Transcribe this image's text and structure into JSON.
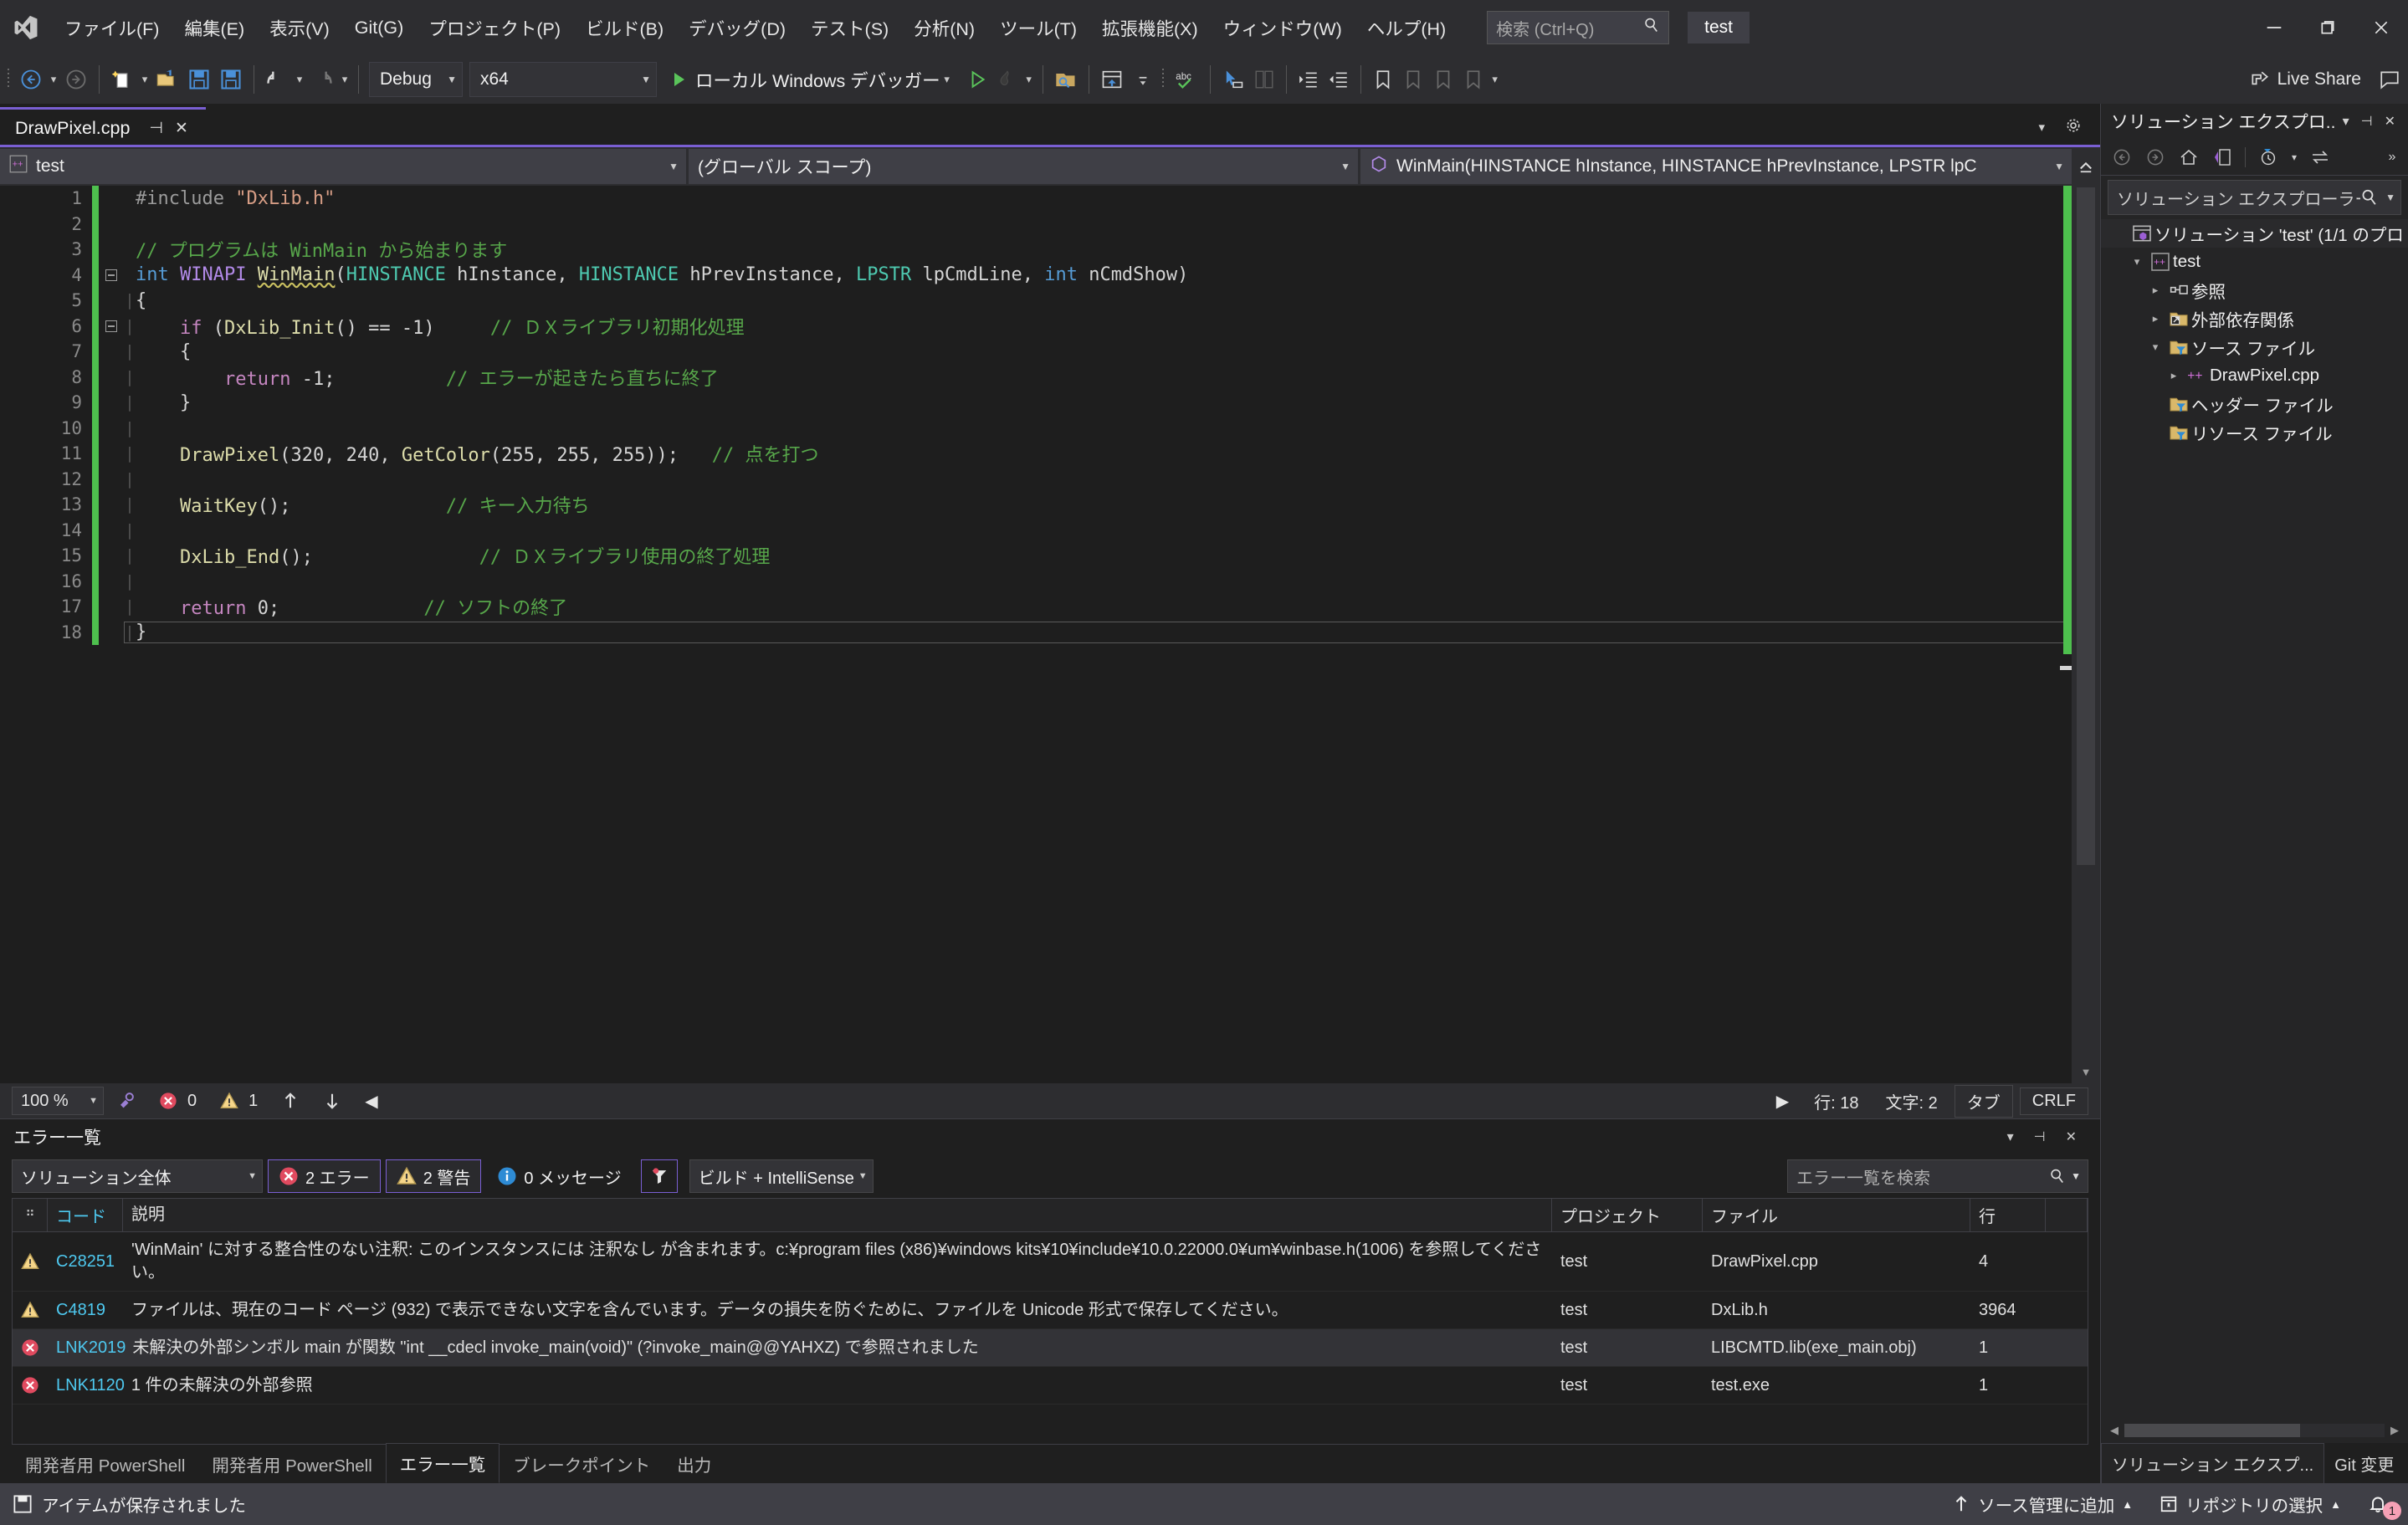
{
  "titlebar": {
    "menus": [
      "ファイル(F)",
      "編集(E)",
      "表示(V)",
      "Git(G)",
      "プロジェクト(P)",
      "ビルド(B)",
      "デバッグ(D)",
      "テスト(S)",
      "分析(N)",
      "ツール(T)",
      "拡張機能(X)",
      "ウィンドウ(W)",
      "ヘルプ(H)"
    ],
    "search_placeholder": "検索 (Ctrl+Q)",
    "project_badge": "test"
  },
  "toolbar": {
    "config": "Debug",
    "platform": "x64",
    "run_label": "ローカル Windows デバッガー",
    "live_share": "Live Share"
  },
  "editor": {
    "tab_name": "DrawPixel.cpp",
    "nav_project": "test",
    "nav_scope": "(グローバル スコープ)",
    "nav_function": "WinMain(HINSTANCE hInstance, HINSTANCE hPrevInstance, LPSTR lpC",
    "lines": [
      {
        "n": 1,
        "fold": "",
        "guide": "",
        "segs": [
          {
            "t": "#include ",
            "c": "k-pre"
          },
          {
            "t": "\"DxLib.h\"",
            "c": "k-str"
          }
        ]
      },
      {
        "n": 2,
        "fold": "",
        "guide": "",
        "segs": []
      },
      {
        "n": 3,
        "fold": "",
        "guide": "",
        "segs": [
          {
            "t": "// プログラムは WinMain から始まります",
            "c": "k-cmt"
          }
        ]
      },
      {
        "n": 4,
        "fold": "-",
        "guide": "",
        "segs": [
          {
            "t": "int",
            "c": "k-kw"
          },
          {
            "t": " ",
            "c": "k-plain"
          },
          {
            "t": "WINAPI",
            "c": "k-macro"
          },
          {
            "t": " ",
            "c": "k-plain"
          },
          {
            "t": "WinMain",
            "c": "k-fn squiggle"
          },
          {
            "t": "(",
            "c": "k-plain"
          },
          {
            "t": "HINSTANCE",
            "c": "k-type"
          },
          {
            "t": " hInstance, ",
            "c": "k-plain"
          },
          {
            "t": "HINSTANCE",
            "c": "k-type"
          },
          {
            "t": " hPrevInstance, ",
            "c": "k-plain"
          },
          {
            "t": "LPSTR",
            "c": "k-type"
          },
          {
            "t": " lpCmdLine, ",
            "c": "k-plain"
          },
          {
            "t": "int",
            "c": "k-kw"
          },
          {
            "t": " nCmdShow)",
            "c": "k-plain"
          }
        ]
      },
      {
        "n": 5,
        "fold": "",
        "guide": "|",
        "segs": [
          {
            "t": "{",
            "c": "k-plain"
          }
        ]
      },
      {
        "n": 6,
        "fold": "-",
        "guide": "|",
        "segs": [
          {
            "t": "    ",
            "c": "k-plain"
          },
          {
            "t": "if",
            "c": "k-kw2"
          },
          {
            "t": " (",
            "c": "k-plain"
          },
          {
            "t": "DxLib_Init",
            "c": "k-fn"
          },
          {
            "t": "() == -1)     ",
            "c": "k-plain"
          },
          {
            "t": "// ＤＸライブラリ初期化処理",
            "c": "k-cmt"
          }
        ]
      },
      {
        "n": 7,
        "fold": "",
        "guide": "|",
        "segs": [
          {
            "t": "    {",
            "c": "k-plain"
          }
        ]
      },
      {
        "n": 8,
        "fold": "",
        "guide": "|",
        "segs": [
          {
            "t": "        ",
            "c": "k-plain"
          },
          {
            "t": "return",
            "c": "k-kw2"
          },
          {
            "t": " -1;          ",
            "c": "k-plain"
          },
          {
            "t": "// エラーが起きたら直ちに終了",
            "c": "k-cmt"
          }
        ]
      },
      {
        "n": 9,
        "fold": "",
        "guide": "|",
        "segs": [
          {
            "t": "    }",
            "c": "k-plain"
          }
        ]
      },
      {
        "n": 10,
        "fold": "",
        "guide": "|",
        "segs": []
      },
      {
        "n": 11,
        "fold": "",
        "guide": "|",
        "segs": [
          {
            "t": "    ",
            "c": "k-plain"
          },
          {
            "t": "DrawPixel",
            "c": "k-fn"
          },
          {
            "t": "(320, 240, ",
            "c": "k-plain"
          },
          {
            "t": "GetColor",
            "c": "k-fn"
          },
          {
            "t": "(255, 255, 255));   ",
            "c": "k-plain"
          },
          {
            "t": "// 点を打つ",
            "c": "k-cmt"
          }
        ]
      },
      {
        "n": 12,
        "fold": "",
        "guide": "|",
        "segs": []
      },
      {
        "n": 13,
        "fold": "",
        "guide": "|",
        "segs": [
          {
            "t": "    ",
            "c": "k-plain"
          },
          {
            "t": "WaitKey",
            "c": "k-fn"
          },
          {
            "t": "();              ",
            "c": "k-plain"
          },
          {
            "t": "// キー入力待ち",
            "c": "k-cmt"
          }
        ]
      },
      {
        "n": 14,
        "fold": "",
        "guide": "|",
        "segs": []
      },
      {
        "n": 15,
        "fold": "",
        "guide": "|",
        "segs": [
          {
            "t": "    ",
            "c": "k-plain"
          },
          {
            "t": "DxLib_End",
            "c": "k-fn"
          },
          {
            "t": "();               ",
            "c": "k-plain"
          },
          {
            "t": "// ＤＸライブラリ使用の終了処理",
            "c": "k-cmt"
          }
        ]
      },
      {
        "n": 16,
        "fold": "",
        "guide": "|",
        "segs": []
      },
      {
        "n": 17,
        "fold": "",
        "guide": "|",
        "segs": [
          {
            "t": "    ",
            "c": "k-plain"
          },
          {
            "t": "return",
            "c": "k-kw2"
          },
          {
            "t": " 0;             ",
            "c": "k-plain"
          },
          {
            "t": "// ソフトの終了",
            "c": "k-cmt"
          }
        ]
      },
      {
        "n": 18,
        "fold": "",
        "guide": "|",
        "segs": [
          {
            "t": "}",
            "c": "k-plain"
          }
        ]
      }
    ],
    "status": {
      "zoom": "100 %",
      "error_count": "0",
      "warning_count": "1",
      "line": "行: 18",
      "col": "文字: 2",
      "tabs": "タブ",
      "eol": "CRLF"
    }
  },
  "errorlist": {
    "title": "エラー一覧",
    "scope": "ソリューション全体",
    "errors_toggle": "2 エラー",
    "warnings_toggle": "2 警告",
    "messages_toggle": "0 メッセージ",
    "build_filter": "ビルド + IntelliSense",
    "search_placeholder": "エラー一覧を検索",
    "columns": [
      "",
      "コード",
      "説明",
      "プロジェクト",
      "ファイル",
      "行",
      ""
    ],
    "rows": [
      {
        "severity": "warning",
        "code": "C28251",
        "description": "'WinMain' に対する整合性のない注釈: このインスタンスには 注釈なし が含まれます。c:¥program files (x86)¥windows kits¥10¥include¥10.0.22000.0¥um¥winbase.h(1006) を参照してください。",
        "project": "test",
        "file": "DrawPixel.cpp",
        "line": "4",
        "selected": false,
        "inline_code": false
      },
      {
        "severity": "warning",
        "code": "C4819",
        "description": "ファイルは、現在のコード ページ (932) で表示できない文字を含んでいます。データの損失を防ぐために、ファイルを Unicode 形式で保存してください。",
        "project": "test",
        "file": "DxLib.h",
        "line": "3964",
        "selected": false,
        "inline_code": false
      },
      {
        "severity": "error",
        "code": "LNK2019",
        "description": "未解決の外部シンボル main が関数 \"int __cdecl invoke_main(void)\" (?invoke_main@@YAHXZ) で参照されました",
        "project": "test",
        "file": "LIBCMTD.lib(exe_main.obj)",
        "line": "1",
        "selected": true,
        "inline_code": true
      },
      {
        "severity": "error",
        "code": "LNK1120",
        "description": "1 件の未解決の外部参照",
        "project": "test",
        "file": "test.exe",
        "line": "1",
        "selected": false,
        "inline_code": true
      }
    ],
    "footer_tabs": [
      {
        "label": "開発者用 PowerShell",
        "active": false
      },
      {
        "label": "開発者用 PowerShell",
        "active": false
      },
      {
        "label": "エラー一覧",
        "active": true
      },
      {
        "label": "ブレークポイント",
        "active": false
      },
      {
        "label": "出力",
        "active": false
      }
    ]
  },
  "solution_explorer": {
    "header_title": "ソリューション エクスプロ...",
    "search_placeholder": "ソリューション エクスプローラー (",
    "tree": [
      {
        "depth": 0,
        "twisty": "",
        "icon": "solution-icon",
        "label": "ソリューション 'test' (1/1 のプロ",
        "selected": true
      },
      {
        "depth": 1,
        "twisty": "▾",
        "icon": "cpp-project-icon",
        "label": "test",
        "selected": false
      },
      {
        "depth": 2,
        "twisty": "▸",
        "icon": "references-icon",
        "label": "参照",
        "selected": false
      },
      {
        "depth": 2,
        "twisty": "▸",
        "icon": "ext-dep-icon",
        "label": "外部依存関係",
        "selected": false
      },
      {
        "depth": 2,
        "twisty": "▾",
        "icon": "filter-folder-icon",
        "label": "ソース ファイル",
        "selected": false
      },
      {
        "depth": 3,
        "twisty": "▸",
        "icon": "cpp-file-icon",
        "label": "DrawPixel.cpp",
        "selected": false
      },
      {
        "depth": 2,
        "twisty": "",
        "icon": "filter-folder-icon",
        "label": "ヘッダー ファイル",
        "selected": false
      },
      {
        "depth": 2,
        "twisty": "",
        "icon": "filter-folder-icon",
        "label": "リソース ファイル",
        "selected": false
      }
    ],
    "tabs": [
      {
        "label": "ソリューション エクスプ...",
        "active": true
      },
      {
        "label": "Git 変更",
        "active": false
      }
    ]
  },
  "statusbar": {
    "message": "アイテムが保存されました",
    "source_control": "ソース管理に追加",
    "repository": "リポジトリの選択",
    "notification_count": "1"
  }
}
